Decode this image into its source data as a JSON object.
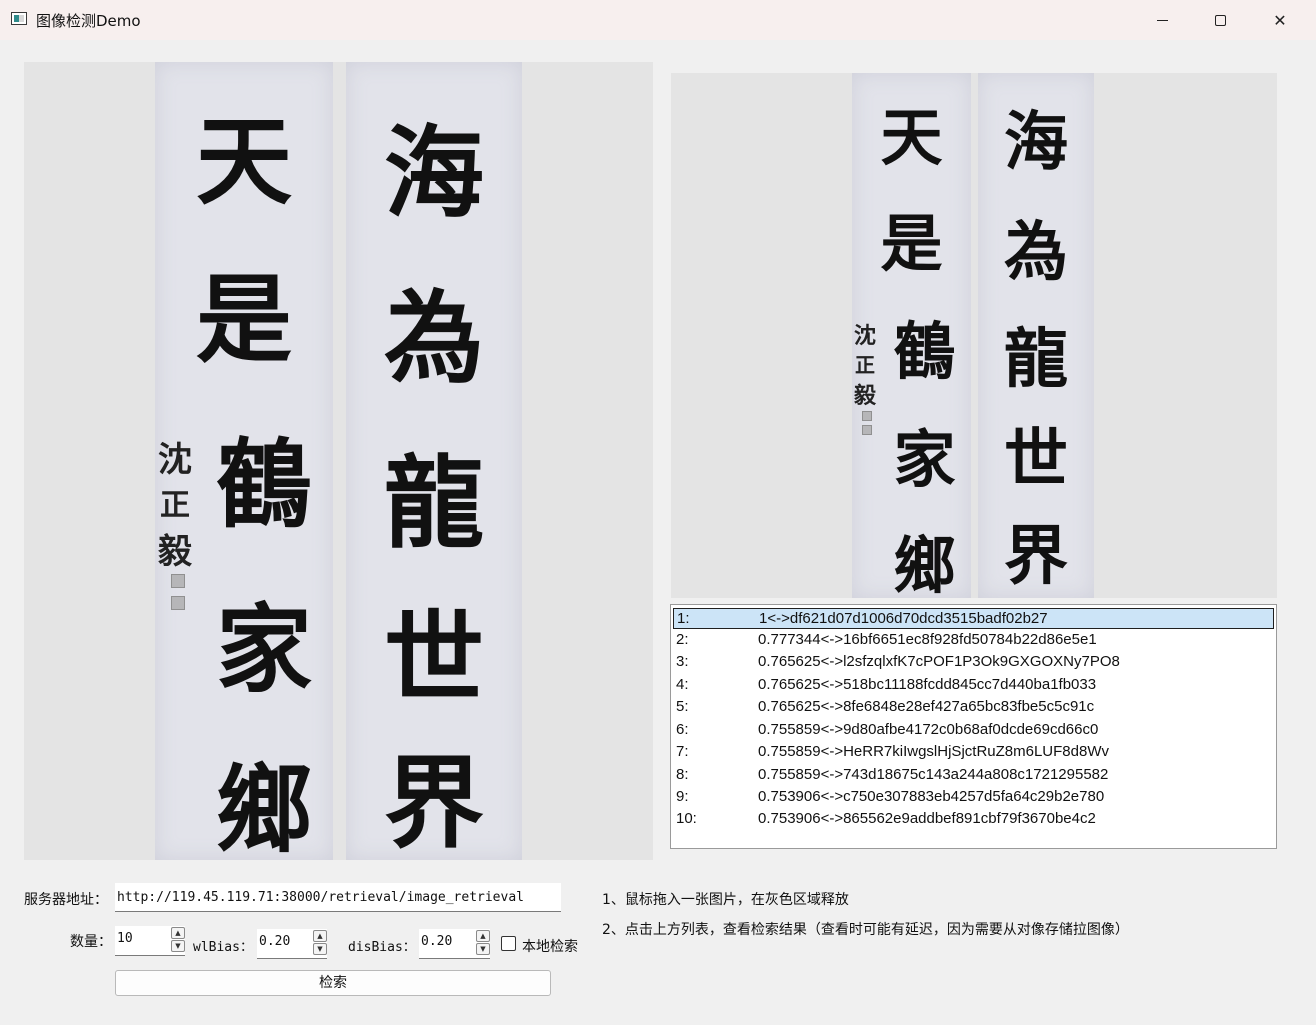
{
  "window": {
    "title": "图像检测Demo",
    "icon": "app-window-icon",
    "controls": {
      "minimize": "—",
      "close": "✕"
    }
  },
  "query_image": {
    "right_column": [
      "海",
      "為",
      "龍",
      "世",
      "界"
    ],
    "left_column": [
      "天",
      "是",
      "鶴",
      "家",
      "鄉"
    ],
    "signature": [
      "沈",
      "正",
      "毅"
    ]
  },
  "result_image": {
    "right_column": [
      "海",
      "為",
      "龍",
      "世",
      "界"
    ],
    "left_column": [
      "天",
      "是",
      "鶴",
      "家",
      "鄉"
    ],
    "signature": [
      "沈",
      "正",
      "毅"
    ]
  },
  "results": [
    {
      "index": "1:",
      "value": "1<->df621d07d1006d70dcd3515badf02b27",
      "selected": true
    },
    {
      "index": "2:",
      "value": "0.777344<->16bf6651ec8f928fd50784b22d86e5e1"
    },
    {
      "index": "3:",
      "value": "0.765625<->l2sfzqlxfK7cPOF1P3Ok9GXGOXNy7PO8"
    },
    {
      "index": "4:",
      "value": "0.765625<->518bc11188fcdd845cc7d440ba1fb033"
    },
    {
      "index": "5:",
      "value": "0.765625<->8fe6848e28ef427a65bc83fbe5c5c91c"
    },
    {
      "index": "6:",
      "value": "0.755859<->9d80afbe4172c0b68af0dcde69cd66c0"
    },
    {
      "index": "7:",
      "value": "0.755859<->HeRR7kiIwgslHjSjctRuZ8m6LUF8d8Wv"
    },
    {
      "index": "8:",
      "value": "0.755859<->743d18675c143a244a808c1721295582"
    },
    {
      "index": "9:",
      "value": "0.753906<->c750e307883eb4257d5fa64c29b2e780"
    },
    {
      "index": "10:",
      "value": "0.753906<->865562e9addbef891cbf79f3670be4c2"
    }
  ],
  "form": {
    "server_label": "服务器地址：",
    "server_value": "http://119.45.119.71:38000/retrieval/image_retrieval",
    "count_label": "数量：",
    "count_value": "10",
    "wl_label": "wlBias：",
    "wl_value": "0.20",
    "dis_label": "disBias：",
    "dis_value": "0.20",
    "local_label": "本地检索",
    "local_checked": false,
    "search_button": "检索"
  },
  "instructions": [
    "1、鼠标拖入一张图片，在灰色区域释放",
    "2、点击上方列表，查看检索结果（查看时可能有延迟，因为需要从对像存储拉图像）"
  ]
}
